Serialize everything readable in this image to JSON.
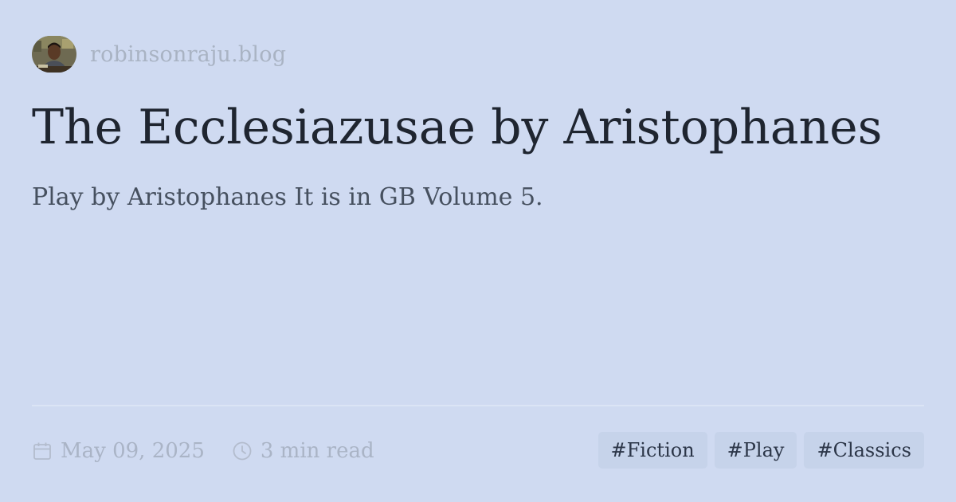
{
  "site": {
    "name": "robinsonraju.blog",
    "avatar_icon": "author-avatar"
  },
  "post": {
    "title": "The Ecclesiazusae by Aristophanes",
    "description": "Play by Aristophanes It is in GB Volume 5.",
    "date": "May 09, 2025",
    "read_time": "3 min read",
    "tags": [
      "#Fiction",
      "#Play",
      "#Classics"
    ]
  },
  "colors": {
    "background": "#cfdaf1",
    "title": "#1f2530",
    "description": "#46505f",
    "muted": "#aab4c6",
    "tag_background": "#c6d3ea",
    "tag_text": "#2c3648"
  },
  "icons": {
    "date": "calendar-icon",
    "read_time": "clock-icon"
  }
}
